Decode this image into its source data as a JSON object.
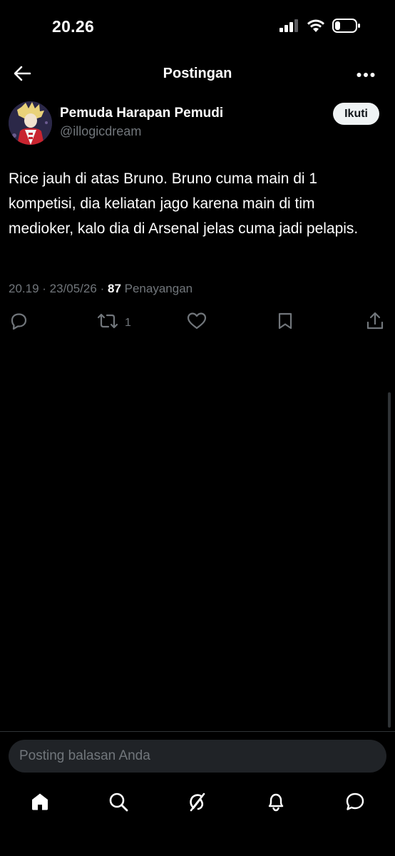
{
  "status_bar": {
    "time": "20.26",
    "icons": [
      "cellular-signal-icon",
      "wifi-icon",
      "battery-icon"
    ]
  },
  "header": {
    "title": "Postingan",
    "back_icon": "back-arrow-icon",
    "more_icon": "more-horizontal-icon"
  },
  "post": {
    "author_name": "Pemuda Harapan Pemudi",
    "author_handle": "@illogicdream",
    "follow_label": "Ikuti",
    "text": "Rice jauh di atas Bruno. Bruno cuma main di 1 kompetisi, dia keliatan jago karena main di tim medioker, kalo dia di Arsenal jelas cuma jadi pelapis.",
    "time": "20.19",
    "date": "23/05/26",
    "views_count": "87",
    "views_label": "Penayangan",
    "actions": {
      "reply_count": "",
      "repost_count": "1",
      "like_count": ""
    }
  },
  "reply": {
    "placeholder": "Posting balasan Anda"
  },
  "tabbar": {
    "items": [
      "home-icon",
      "search-icon",
      "grok-icon",
      "notifications-icon",
      "messages-icon"
    ]
  },
  "colors": {
    "background": "#000000",
    "text_primary": "#ffffff",
    "text_secondary": "#71767b",
    "follow_bg": "#eff3f4",
    "input_bg": "#202327"
  }
}
